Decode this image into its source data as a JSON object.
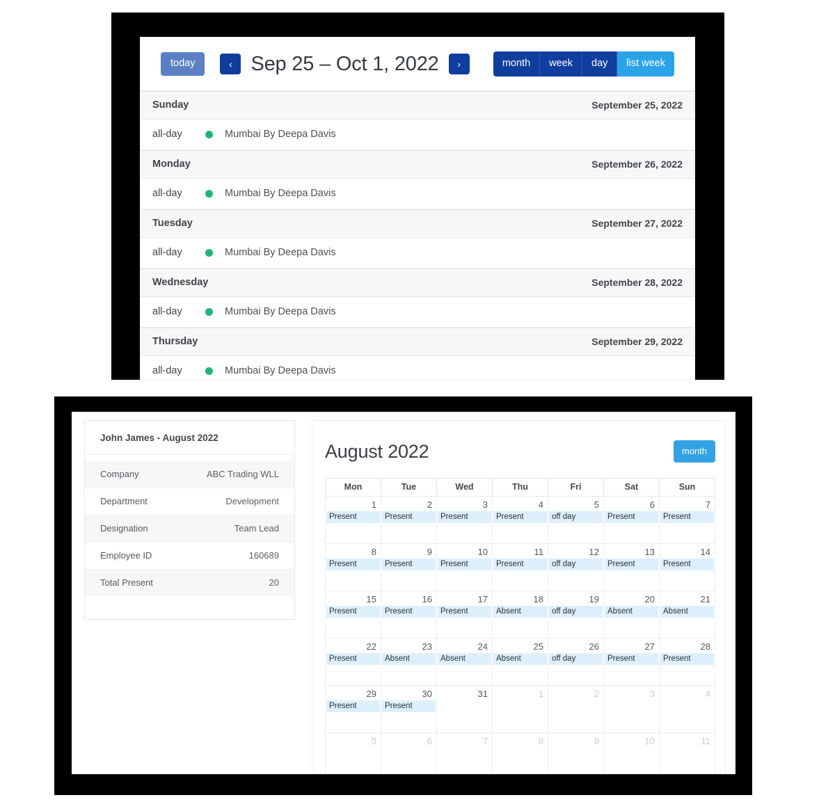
{
  "top_panel": {
    "toolbar": {
      "today_label": "today",
      "prev_icon": "‹",
      "next_icon": "›",
      "title": "Sep 25 – Oct 1, 2022",
      "views": [
        {
          "label": "month",
          "active": false
        },
        {
          "label": "week",
          "active": false
        },
        {
          "label": "day",
          "active": false
        },
        {
          "label": "list week",
          "active": true
        }
      ]
    },
    "accent_dark_blue": "#0f3e9e",
    "accent_light_blue": "#2aa3e8",
    "event_dot_color": "#21b573",
    "days": [
      {
        "weekday": "Sunday",
        "date": "September 25, 2022",
        "events": [
          {
            "time": "all-day",
            "title": "Mumbai By Deepa Davis"
          }
        ]
      },
      {
        "weekday": "Monday",
        "date": "September 26, 2022",
        "events": [
          {
            "time": "all-day",
            "title": "Mumbai By Deepa Davis"
          }
        ]
      },
      {
        "weekday": "Tuesday",
        "date": "September 27, 2022",
        "events": [
          {
            "time": "all-day",
            "title": "Mumbai By Deepa Davis"
          }
        ]
      },
      {
        "weekday": "Wednesday",
        "date": "September 28, 2022",
        "events": [
          {
            "time": "all-day",
            "title": "Mumbai By Deepa Davis"
          }
        ]
      },
      {
        "weekday": "Thursday",
        "date": "September 29, 2022",
        "events": [
          {
            "time": "all-day",
            "title": "Mumbai By Deepa Davis"
          }
        ]
      }
    ]
  },
  "bottom_panel": {
    "info": {
      "heading": "John James - August 2022",
      "rows": [
        {
          "key": "Company",
          "value": "ABC Trading WLL"
        },
        {
          "key": "Department",
          "value": "Development"
        },
        {
          "key": "Designation",
          "value": "Team Lead"
        },
        {
          "key": "Employee ID",
          "value": "160689"
        },
        {
          "key": "Total Present",
          "value": "20"
        }
      ]
    },
    "calendar": {
      "title": "August 2022",
      "month_button": "month",
      "weekdays": [
        "Mon",
        "Tue",
        "Wed",
        "Thu",
        "Fri",
        "Sat",
        "Sun"
      ],
      "chip_bg": "#ddeffb",
      "weeks": [
        [
          {
            "day": "1",
            "other": false,
            "status": "Present"
          },
          {
            "day": "2",
            "other": false,
            "status": "Present"
          },
          {
            "day": "3",
            "other": false,
            "status": "Present"
          },
          {
            "day": "4",
            "other": false,
            "status": "Present"
          },
          {
            "day": "5",
            "other": false,
            "status": "off day"
          },
          {
            "day": "6",
            "other": false,
            "status": "Present"
          },
          {
            "day": "7",
            "other": false,
            "status": "Present"
          }
        ],
        [
          {
            "day": "8",
            "other": false,
            "status": "Present"
          },
          {
            "day": "9",
            "other": false,
            "status": "Present"
          },
          {
            "day": "10",
            "other": false,
            "status": "Present"
          },
          {
            "day": "11",
            "other": false,
            "status": "Present"
          },
          {
            "day": "12",
            "other": false,
            "status": "off day"
          },
          {
            "day": "13",
            "other": false,
            "status": "Present"
          },
          {
            "day": "14",
            "other": false,
            "status": "Present"
          }
        ],
        [
          {
            "day": "15",
            "other": false,
            "status": "Present"
          },
          {
            "day": "16",
            "other": false,
            "status": "Present"
          },
          {
            "day": "17",
            "other": false,
            "status": "Present"
          },
          {
            "day": "18",
            "other": false,
            "status": "Absent"
          },
          {
            "day": "19",
            "other": false,
            "status": "off day"
          },
          {
            "day": "20",
            "other": false,
            "status": "Absent"
          },
          {
            "day": "21",
            "other": false,
            "status": "Absent"
          }
        ],
        [
          {
            "day": "22",
            "other": false,
            "status": "Present"
          },
          {
            "day": "23",
            "other": false,
            "status": "Absent"
          },
          {
            "day": "24",
            "other": false,
            "status": "Absent"
          },
          {
            "day": "25",
            "other": false,
            "status": "Absent"
          },
          {
            "day": "26",
            "other": false,
            "status": "off day"
          },
          {
            "day": "27",
            "other": false,
            "status": "Present"
          },
          {
            "day": "28",
            "other": false,
            "status": "Present"
          }
        ],
        [
          {
            "day": "29",
            "other": false,
            "status": "Present"
          },
          {
            "day": "30",
            "other": false,
            "status": "Present"
          },
          {
            "day": "31",
            "other": false,
            "status": ""
          },
          {
            "day": "1",
            "other": true,
            "status": ""
          },
          {
            "day": "2",
            "other": true,
            "status": ""
          },
          {
            "day": "3",
            "other": true,
            "status": ""
          },
          {
            "day": "4",
            "other": true,
            "status": ""
          }
        ],
        [
          {
            "day": "5",
            "other": true,
            "status": ""
          },
          {
            "day": "6",
            "other": true,
            "status": ""
          },
          {
            "day": "7",
            "other": true,
            "status": ""
          },
          {
            "day": "8",
            "other": true,
            "status": ""
          },
          {
            "day": "9",
            "other": true,
            "status": ""
          },
          {
            "day": "10",
            "other": true,
            "status": ""
          },
          {
            "day": "11",
            "other": true,
            "status": ""
          }
        ]
      ]
    }
  }
}
